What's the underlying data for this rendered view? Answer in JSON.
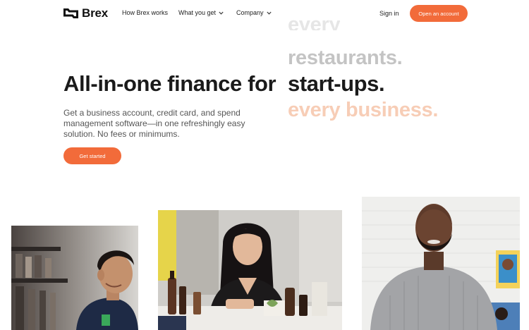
{
  "nav": {
    "brand": "Brex",
    "links": [
      {
        "label": "How Brex works",
        "dropdown": false
      },
      {
        "label": "What you get",
        "dropdown": true
      },
      {
        "label": "Company",
        "dropdown": true
      }
    ],
    "signin": "Sign in",
    "open_account": "Open an account"
  },
  "hero": {
    "headline": "All-in-one finance for",
    "rotating_words": {
      "ghost": "every",
      "above": "restaurants.",
      "current": "start-ups.",
      "below": "every business."
    },
    "subtext_lines": [
      "Get a business account, credit card, and spend",
      "management software—in one refreshingly easy",
      "solution. No fees or minimums."
    ],
    "cta": "Get started"
  },
  "photos": [
    {
      "description": "smiling-man-in-warehouse"
    },
    {
      "description": "woman-at-table-with-products"
    },
    {
      "description": "bearded-man-in-grey-sweater"
    }
  ],
  "colors": {
    "accent": "#f26b3a",
    "rotating_above": "#c4c4c4",
    "rotating_below": "#f7cdb6",
    "text": "#1a1a1a"
  }
}
